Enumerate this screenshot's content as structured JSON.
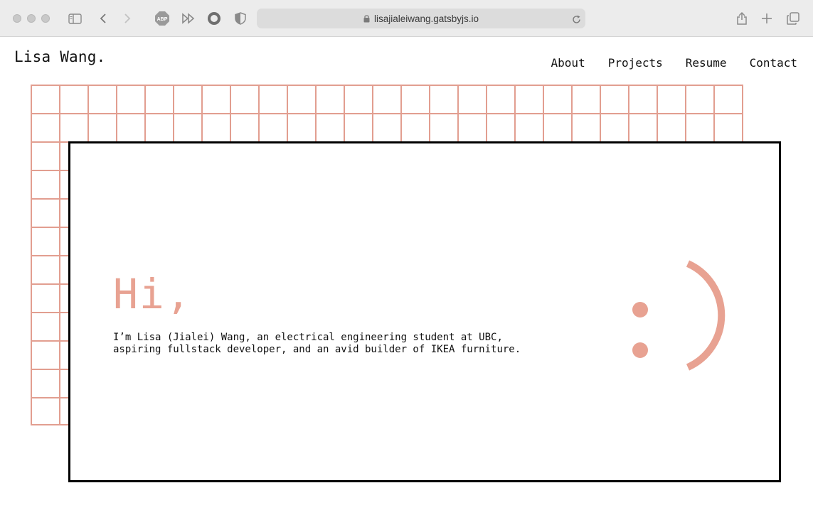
{
  "browser": {
    "url": "lisajialeiwang.gatsbyjs.io",
    "extension_badge": "ABP",
    "icons": [
      "sidebar-icon",
      "back-icon",
      "forward-icon",
      "adblock-icon",
      "fast-forward-icon",
      "record-icon",
      "privacy-shield-icon",
      "lock-icon",
      "reload-icon",
      "share-icon",
      "new-tab-icon",
      "tabs-overview-icon"
    ]
  },
  "site": {
    "logo": "Lisa Wang.",
    "nav": [
      {
        "label": "About"
      },
      {
        "label": "Projects"
      },
      {
        "label": "Resume"
      },
      {
        "label": "Contact"
      }
    ]
  },
  "hero": {
    "greeting": "Hi,",
    "intro": "I’m Lisa (Jialei) Wang, an electrical engineering student at UBC, aspiring fullstack developer, and an avid builder of IKEA furniture."
  },
  "colors": {
    "accent": "#e8a292",
    "grid": "#e29e90",
    "border": "#000000"
  }
}
